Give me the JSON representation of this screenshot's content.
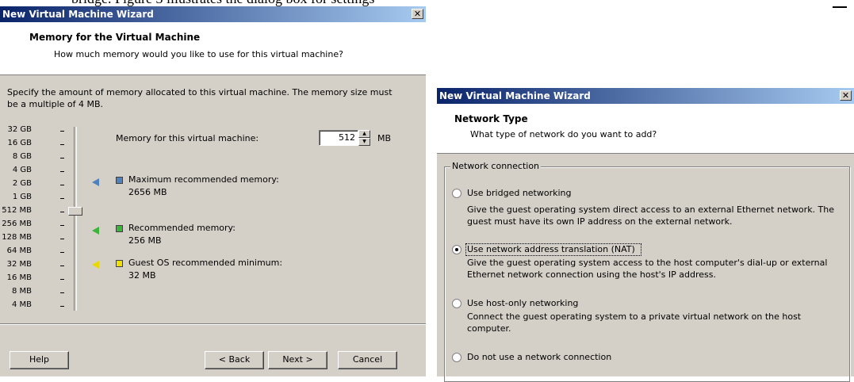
{
  "doc_fragment": "bridge. Figure 3 illustrates the dialog box for settings",
  "memory_wizard": {
    "title": "New Virtual Machine Wizard",
    "header_title": "Memory for the Virtual Machine",
    "header_subtitle": "How much memory would you like to use for this virtual machine?",
    "description": "Specify the amount of memory allocated to this virtual machine. The memory size must be a multiple of 4 MB.",
    "scale_labels": [
      "32 GB",
      "16 GB",
      "8 GB",
      "4 GB",
      "2 GB",
      "1 GB",
      "512 MB",
      "256 MB",
      "128 MB",
      "64 MB",
      "32 MB",
      "16 MB",
      "8 MB",
      "4 MB"
    ],
    "memory_label": "Memory for this virtual machine:",
    "memory_value": "512",
    "memory_unit": "MB",
    "slider_value": "512 MB",
    "max_label": "Maximum recommended memory:",
    "max_value": "2656 MB",
    "rec_label": "Recommended memory:",
    "rec_value": "256 MB",
    "min_label": "Guest OS recommended minimum:",
    "min_value": "32 MB",
    "colors": {
      "max": "#4f81bd",
      "rec": "#3cb43c",
      "min": "#f0e000"
    },
    "buttons": {
      "help": "Help",
      "back": "< Back",
      "next": "Next >",
      "cancel": "Cancel"
    }
  },
  "network_wizard": {
    "title": "New Virtual Machine Wizard",
    "header_title": "Network Type",
    "header_subtitle": "What type of network do you want to add?",
    "group_label": "Network connection",
    "options": [
      {
        "label": "Use bridged networking",
        "desc": "Give the guest operating system direct access to an external Ethernet network. The guest must have its own IP address on the external network.",
        "selected": false
      },
      {
        "label": "Use network address translation (NAT)",
        "desc": "Give the guest operating system access to the host computer's dial-up or external Ethernet network connection using the host's IP address.",
        "selected": true
      },
      {
        "label": "Use host-only networking",
        "desc": "Connect the guest operating system to a private virtual network on the host computer.",
        "selected": false
      },
      {
        "label": "Do not use a network connection",
        "desc": "",
        "selected": false
      }
    ]
  }
}
